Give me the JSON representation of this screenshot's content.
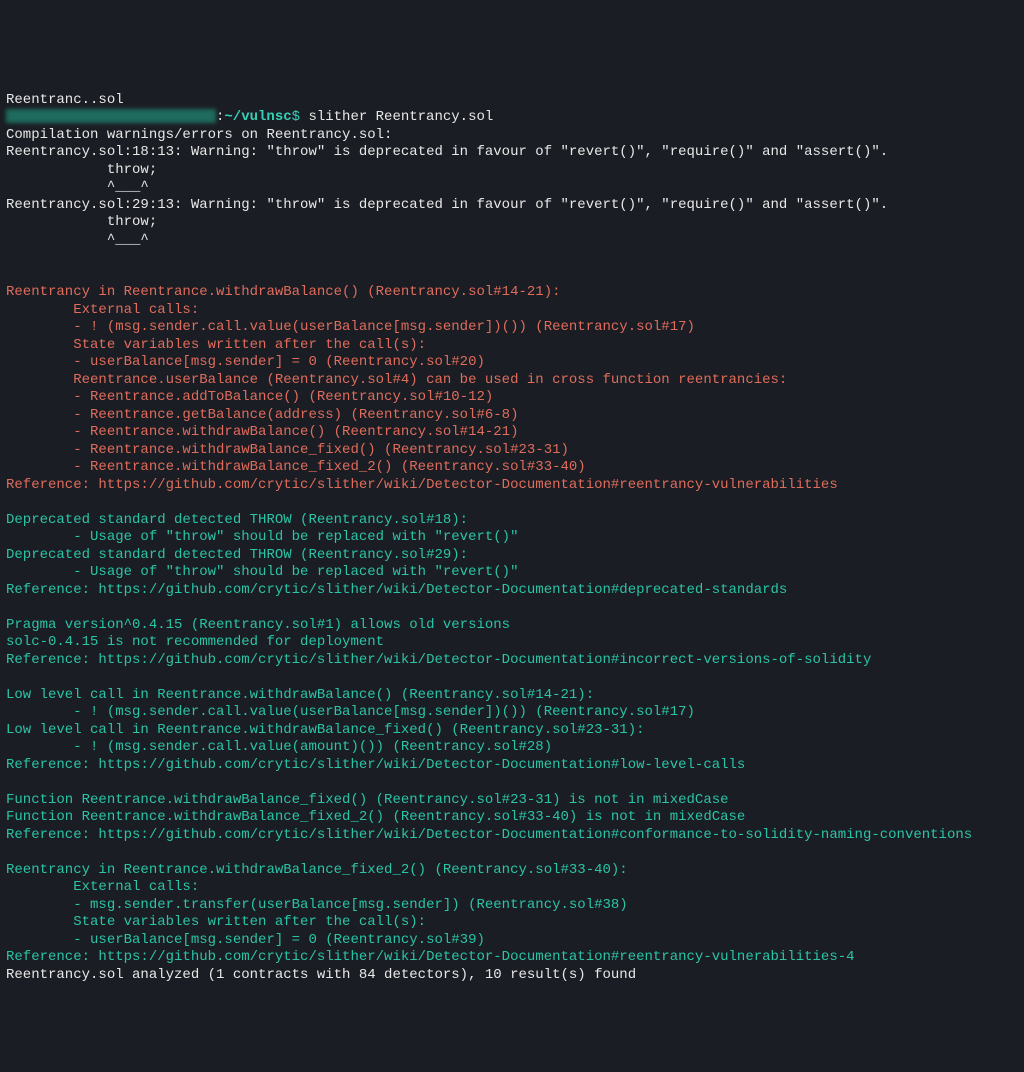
{
  "prompt": {
    "path": "~/vulnsc",
    "dollar": "$",
    "command": "slither Reentrancy.sol"
  },
  "top_cut": "Reentranc..sol",
  "warnings": {
    "header": "Compilation warnings/errors on Reentrancy.sol:",
    "w1": "Reentrancy.sol:18:13: Warning: \"throw\" is deprecated in favour of \"revert()\", \"require()\" and \"assert()\".",
    "throw1": "            throw;",
    "caret1": "            ^___^",
    "w2": "Reentrancy.sol:29:13: Warning: \"throw\" is deprecated in favour of \"revert()\", \"require()\" and \"assert()\".",
    "throw2": "            throw;",
    "caret2": "            ^___^"
  },
  "red": {
    "l1": "Reentrancy in Reentrance.withdrawBalance() (Reentrancy.sol#14-21):",
    "l2": "        External calls:",
    "l3": "        - ! (msg.sender.call.value(userBalance[msg.sender])()) (Reentrancy.sol#17)",
    "l4": "        State variables written after the call(s):",
    "l5": "        - userBalance[msg.sender] = 0 (Reentrancy.sol#20)",
    "l6": "        Reentrance.userBalance (Reentrancy.sol#4) can be used in cross function reentrancies:",
    "l7": "        - Reentrance.addToBalance() (Reentrancy.sol#10-12)",
    "l8": "        - Reentrance.getBalance(address) (Reentrancy.sol#6-8)",
    "l9": "        - Reentrance.withdrawBalance() (Reentrancy.sol#14-21)",
    "l10": "        - Reentrance.withdrawBalance_fixed() (Reentrancy.sol#23-31)",
    "l11": "        - Reentrance.withdrawBalance_fixed_2() (Reentrancy.sol#33-40)",
    "ref": "Reference: https://github.com/crytic/slither/wiki/Detector-Documentation#reentrancy-vulnerabilities"
  },
  "dep": {
    "l1": "Deprecated standard detected THROW (Reentrancy.sol#18):",
    "l2": "        - Usage of \"throw\" should be replaced with \"revert()\"",
    "l3": "Deprecated standard detected THROW (Reentrancy.sol#29):",
    "l4": "        - Usage of \"throw\" should be replaced with \"revert()\"",
    "ref": "Reference: https://github.com/crytic/slither/wiki/Detector-Documentation#deprecated-standards"
  },
  "pragma": {
    "l1": "Pragma version^0.4.15 (Reentrancy.sol#1) allows old versions",
    "l2": "solc-0.4.15 is not recommended for deployment",
    "ref": "Reference: https://github.com/crytic/slither/wiki/Detector-Documentation#incorrect-versions-of-solidity"
  },
  "low": {
    "l1": "Low level call in Reentrance.withdrawBalance() (Reentrancy.sol#14-21):",
    "l2": "        - ! (msg.sender.call.value(userBalance[msg.sender])()) (Reentrancy.sol#17)",
    "l3": "Low level call in Reentrance.withdrawBalance_fixed() (Reentrancy.sol#23-31):",
    "l4": "        - ! (msg.sender.call.value(amount)()) (Reentrancy.sol#28)",
    "ref": "Reference: https://github.com/crytic/slither/wiki/Detector-Documentation#low-level-calls"
  },
  "mixed": {
    "l1": "Function Reentrance.withdrawBalance_fixed() (Reentrancy.sol#23-31) is not in mixedCase",
    "l2": "Function Reentrance.withdrawBalance_fixed_2() (Reentrancy.sol#33-40) is not in mixedCase",
    "ref": "Reference: https://github.com/crytic/slither/wiki/Detector-Documentation#conformance-to-solidity-naming-conventions"
  },
  "reent2": {
    "l1": "Reentrancy in Reentrance.withdrawBalance_fixed_2() (Reentrancy.sol#33-40):",
    "l2": "        External calls:",
    "l3": "        - msg.sender.transfer(userBalance[msg.sender]) (Reentrancy.sol#38)",
    "l4": "        State variables written after the call(s):",
    "l5": "        - userBalance[msg.sender] = 0 (Reentrancy.sol#39)",
    "ref": "Reference: https://github.com/crytic/slither/wiki/Detector-Documentation#reentrancy-vulnerabilities-4"
  },
  "summary": "Reentrancy.sol analyzed (1 contracts with 84 detectors), 10 result(s) found"
}
